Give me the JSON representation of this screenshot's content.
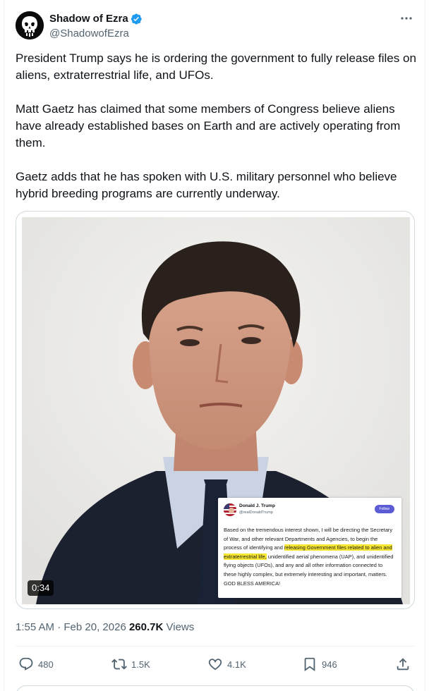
{
  "author": {
    "display_name": "Shadow of Ezra",
    "handle": "@ShadowofEzra",
    "verified": true,
    "avatar_icon": "skull-avatar-icon",
    "verified_color": "#1d9bf0"
  },
  "tweet": {
    "paragraphs": [
      "President Trump says he is ordering the government to fully release files on aliens, extraterrestrial life, and UFOs.",
      "Matt Gaetz has claimed that some members of Congress believe aliens have already established bases on Earth and are actively operating from them.",
      "Gaetz adds that he has spoken with U.S. military personnel who believe hybrid breeding programs are currently underway."
    ]
  },
  "media": {
    "duration": "0:34",
    "embedded_post": {
      "name": "Donald J. Trump",
      "handle": "@realDonaldTrump",
      "follow_label": "Follow",
      "body_before": "Based on the tremendous interest shown, I will be directing the Secretary of War, and other relevant Departments and Agencies, to begin the process of identifying and ",
      "body_highlight": "releasing Government files related to alien and extraterrestrial life,",
      "body_after": " unidentified aerial phenomena (UAP), and unidentified flying objects (UFOs), and any and all other information connected to these highly complex, but extremely interesting and important, matters. GOD BLESS AMERICA!"
    }
  },
  "meta": {
    "time": "1:55 AM",
    "separator": "·",
    "date": "Feb 20, 2026",
    "views_count": "260.7K",
    "views_label": "Views"
  },
  "actions": {
    "replies": "480",
    "reposts": "1.5K",
    "likes": "4.1K",
    "bookmarks": "946"
  },
  "colors": {
    "text_primary": "#0f1419",
    "text_secondary": "#536471",
    "border": "#cfd9de",
    "highlight": "#f7e733"
  }
}
